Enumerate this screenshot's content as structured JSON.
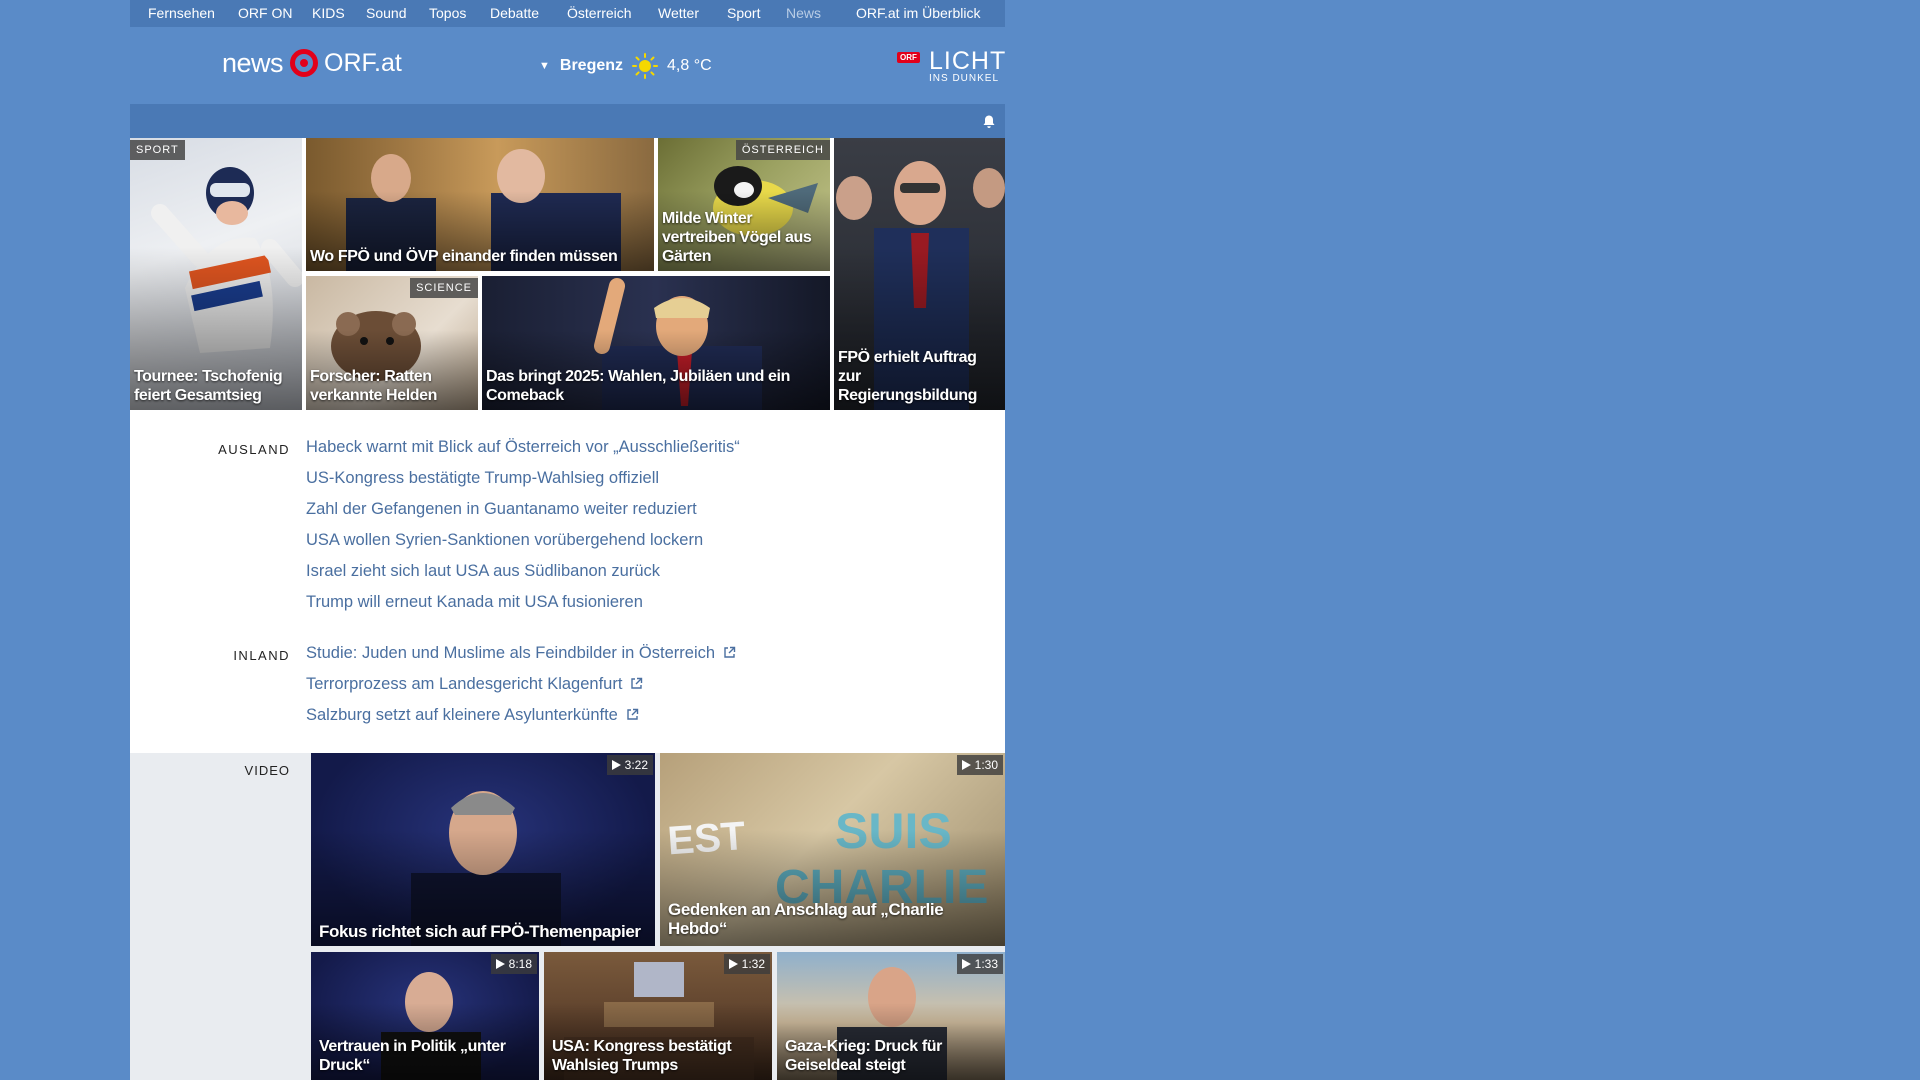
{
  "topnav": {
    "items": [
      "Fernsehen",
      "ORF ON",
      "KIDS",
      "Sound",
      "Topos",
      "Debatte",
      "Österreich",
      "Wetter",
      "Sport",
      "News"
    ],
    "overview": "ORF.at im Überblick"
  },
  "header": {
    "logo_news": "news",
    "logo_orf": "ORF.at",
    "weather": {
      "city": "Bregenz",
      "temp": "4,8 °C",
      "icon": "sun-icon"
    },
    "licht": {
      "badge": "ORF",
      "big": "LICHT",
      "small": "INS DUNKEL"
    }
  },
  "tiles": [
    {
      "caption": "Tournee: Tschofenig feiert Gesamtsieg",
      "tag": "SPORT"
    },
    {
      "caption": "Wo FPÖ und ÖVP einander finden müssen",
      "tag": ""
    },
    {
      "caption": "Milde Winter vertreiben Vögel aus Gärten",
      "tag": "ÖSTERREICH"
    },
    {
      "caption": "FPÖ erhielt Auftrag zur Regierungsbildung",
      "tag": ""
    },
    {
      "caption": "Forscher: Ratten verkannte Helden",
      "tag": "SCIENCE"
    },
    {
      "caption": "Das bringt 2025: Wahlen, Jubiläen und ein Comeback",
      "tag": ""
    }
  ],
  "ausland": {
    "label": "AUSLAND",
    "headlines": [
      "Habeck warnt mit Blick auf Österreich vor „Ausschließeritis“",
      "US-Kongress bestätigte Trump-Wahlsieg offiziell",
      "Zahl der Gefangenen in Guantanamo weiter reduziert",
      "USA wollen Syrien-Sanktionen vorübergehend lockern",
      "Israel zieht sich laut USA aus Südlibanon zurück",
      "Trump will erneut Kanada mit USA fusionieren"
    ]
  },
  "inland": {
    "label": "INLAND",
    "headlines": [
      "Studie: Juden und Muslime als Feindbilder in Österreich",
      "Terrorprozess am Landesgericht Klagenfurt",
      "Salzburg setzt auf kleinere Asylunterkünfte"
    ]
  },
  "video": {
    "label": "VIDEO",
    "items": [
      {
        "caption": "Fokus richtet sich auf FPÖ-Themenpapier",
        "duration": "3:22"
      },
      {
        "caption": "Gedenken an Anschlag auf „Charlie Hebdo“",
        "duration": "1:30"
      },
      {
        "caption": "Vertrauen in Politik „unter Druck“",
        "duration": "8:18"
      },
      {
        "caption": "USA: Kongress bestätigt Wahlsieg Trumps",
        "duration": "1:32"
      },
      {
        "caption": "Gaza-Krieg: Druck für Geiseldeal steigt",
        "duration": "1:33"
      }
    ]
  },
  "colors": {
    "background": "#5a8bc8",
    "nav": "#4a79b5",
    "link": "#4a6fa0",
    "orf_red": "#e2001a"
  }
}
